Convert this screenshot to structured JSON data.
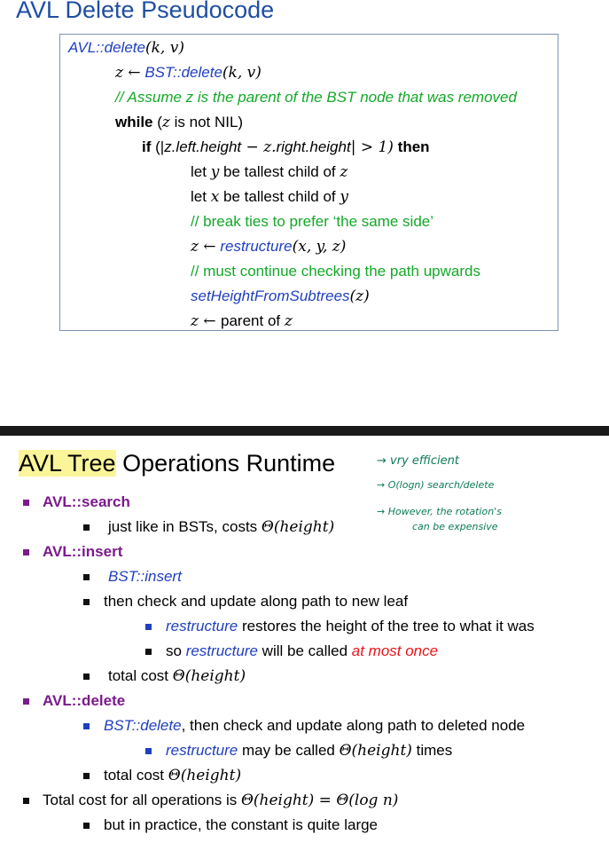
{
  "slide1": {
    "title": "AVL Delete Pseudocode",
    "code": {
      "l1_fn": "AVL::delete",
      "l1_args": "(k, v)",
      "l2_lhs": "z ←",
      "l2_fn": "BST::delete",
      "l2_args": "(k, v)",
      "l3": "// Assume z is the parent of the BST node that was removed",
      "l4_kw": "while",
      "l4_rest_a": "(",
      "l4_z": "z",
      "l4_rest_b": " is not NIL)",
      "l5_kw": "if",
      "l5_a": "(|",
      "l5_b": "z.left.height",
      "l5_c": " − z.",
      "l5_d": "right.height",
      "l5_e": "| > 1)",
      "l5_then": "then",
      "l6_a": "let ",
      "l6_y": "y",
      "l6_b": "  be tallest child of ",
      "l6_z": "z",
      "l7_a": "let ",
      "l7_x": "x",
      "l7_b": "  be tallest child of ",
      "l7_y": "y",
      "l8": "// break ties to prefer ‘the same side’",
      "l9_lhs": "z ←",
      "l9_fn": "restructure",
      "l9_args": "(x, y, z)",
      "l10": "// must continue checking the path upwards",
      "l11_fn": "setHeightFromSubtrees",
      "l11_args": "(z)",
      "l12_a": "z ← ",
      "l12_b": "parent of ",
      "l12_z": "z"
    }
  },
  "slide2": {
    "title_hl": "AVL Tree",
    "title_rest": " Operations Runtime",
    "notes": {
      "n1": "→ vry efficient",
      "n2": "→ O(logn) search/delete",
      "n3a": "→ However, the rotation's",
      "n3b": "can be  expensive"
    },
    "search_label": "AVL::search",
    "search_sub_a": "just like in BSTs, costs ",
    "search_sub_b": "Θ(height)",
    "insert_label": "AVL::insert",
    "insert_sub1": "BST::insert",
    "insert_sub2": "then check and update along path to new leaf",
    "insert_subsub1_a": "restructure",
    "insert_subsub1_b": " restores the height of the tree  to what it was",
    "insert_subsub2_a": "so ",
    "insert_subsub2_b": "restructure",
    "insert_subsub2_c": " will be called ",
    "insert_subsub2_d": "at most once",
    "insert_sub3_a": "total cost ",
    "insert_sub3_b": "Θ(height)",
    "delete_label": "AVL::delete",
    "delete_sub1_a": "BST::delete",
    "delete_sub1_b": ", then check  and update along path to deleted  node",
    "delete_subsub1_a": "restructure",
    "delete_subsub1_b": " may be called ",
    "delete_subsub1_c": "Θ(height)",
    "delete_subsub1_d": " times",
    "delete_sub2_a": "total cost ",
    "delete_sub2_b": "Θ(height)",
    "total_a": "Total cost for all operations is ",
    "total_b": "Θ(height) = Θ(log n)",
    "total_sub": "but in practice, the constant is quite large"
  }
}
